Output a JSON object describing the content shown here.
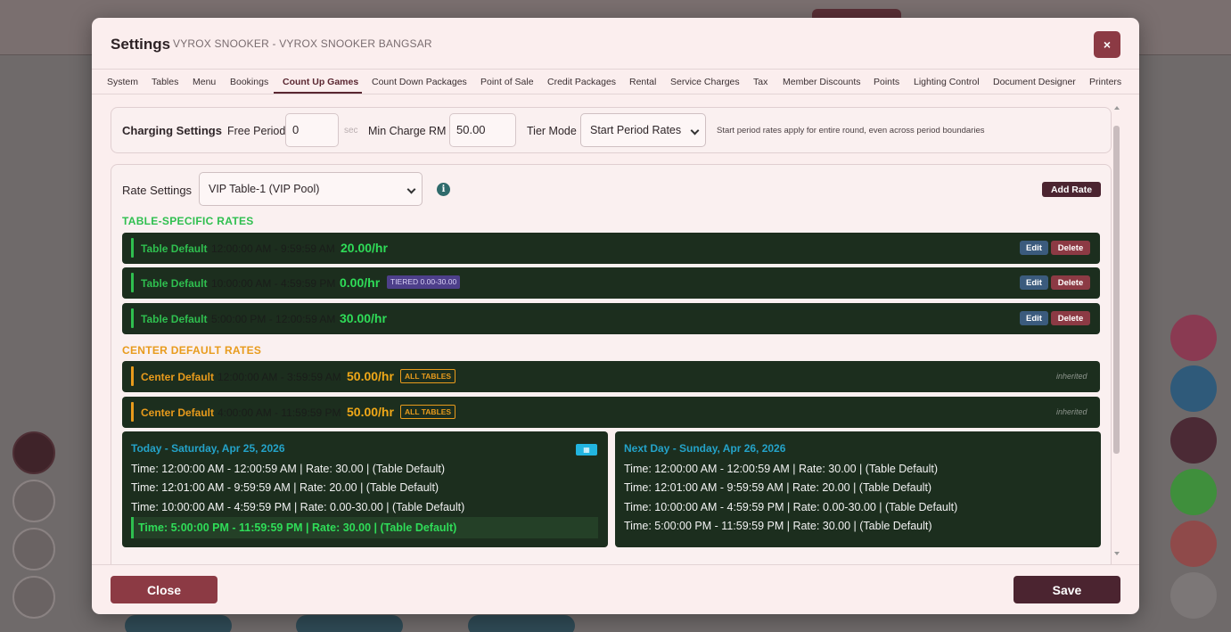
{
  "modal": {
    "title": "Settings",
    "subtitle": "VYROX SNOOKER - VYROX SNOOKER BANGSAR",
    "close_icon": "×"
  },
  "tabs": [
    {
      "label": "System"
    },
    {
      "label": "Tables"
    },
    {
      "label": "Menu"
    },
    {
      "label": "Bookings"
    },
    {
      "label": "Count Up Games",
      "active": true
    },
    {
      "label": "Count Down Packages"
    },
    {
      "label": "Point of Sale"
    },
    {
      "label": "Credit Packages"
    },
    {
      "label": "Rental"
    },
    {
      "label": "Service Charges"
    },
    {
      "label": "Tax"
    },
    {
      "label": "Member Discounts"
    },
    {
      "label": "Points"
    },
    {
      "label": "Lighting Control"
    },
    {
      "label": "Document Designer"
    },
    {
      "label": "Printers"
    }
  ],
  "charging": {
    "title": "Charging Settings",
    "free_period_label": "Free Period",
    "free_period_value": "0",
    "free_period_unit": "sec",
    "min_charge_label": "Min Charge",
    "min_charge_currency": "RM",
    "min_charge_value": "50.00",
    "tier_mode_label": "Tier Mode",
    "tier_mode_value": "Start Period Rates",
    "tier_mode_hint": "Start period rates apply for entire round, even across period boundaries"
  },
  "rate_settings": {
    "title": "Rate Settings",
    "table_select": "VIP Table-1 (VIP Pool)",
    "info_icon": "i",
    "add_rate_label": "Add Rate",
    "table_specific_heading": "TABLE-SPECIFIC RATES",
    "center_default_heading": "CENTER DEFAULT RATES",
    "edit_label": "Edit",
    "delete_label": "Delete",
    "table_rates": [
      {
        "name": "Table Default",
        "time": "12:00:00 AM - 9:59:59 AM",
        "price": "20.00/hr",
        "badge": ""
      },
      {
        "name": "Table Default",
        "time": "10:00:00 AM - 4:59:59 PM",
        "price": "0.00/hr",
        "badge": "TIERED 0.00-30.00"
      },
      {
        "name": "Table Default",
        "time": "5:00:00 PM - 12:00:59 AM",
        "price": "30.00/hr",
        "badge": ""
      }
    ],
    "center_rates": [
      {
        "name": "Center Default",
        "time": "12:00:00 AM - 3:59:59 AM",
        "price": "50.00/hr",
        "badge": "ALL TABLES",
        "note": "inherited"
      },
      {
        "name": "Center Default",
        "time": "4:00:00 AM - 11:59:59 PM",
        "price": "50.00/hr",
        "badge": "ALL TABLES",
        "note": "inherited"
      }
    ],
    "today": {
      "title": "Today - Saturday, Apr 25, 2026",
      "calendar_icon": "▦",
      "lines": [
        "Time: 12:00:00 AM - 12:00:59 AM | Rate: 30.00 | (Table Default)",
        "Time: 12:01:00 AM - 9:59:59 AM | Rate: 20.00 | (Table Default)",
        "Time: 10:00:00 AM - 4:59:59 PM | Rate: 0.00-30.00 | (Table Default)",
        "Time: 5:00:00 PM - 11:59:59 PM | Rate: 30.00 | (Table Default)"
      ]
    },
    "next_day": {
      "title": "Next Day - Sunday, Apr 26, 2026",
      "lines": [
        "Time: 12:00:00 AM - 12:00:59 AM | Rate: 30.00 | (Table Default)",
        "Time: 12:01:00 AM - 9:59:59 AM | Rate: 20.00 | (Table Default)",
        "Time: 10:00:00 AM - 4:59:59 PM | Rate: 0.00-30.00 | (Table Default)",
        "Time: 5:00:00 PM - 11:59:59 PM | Rate: 30.00 | (Table Default)"
      ]
    }
  },
  "footer": {
    "close_label": "Close",
    "save_label": "Save"
  },
  "colors": {
    "brand": "#4b2430",
    "danger": "#8c3a44",
    "table_rate": "#2fbf4f",
    "center_rate": "#e89b1c",
    "date_heading": "#24a3c9"
  }
}
